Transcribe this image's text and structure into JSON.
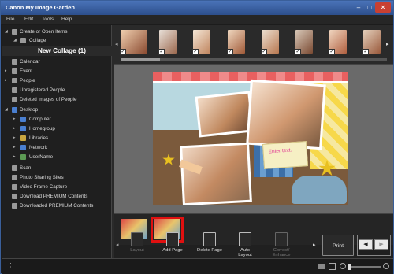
{
  "window": {
    "title": "Canon My Image Garden",
    "min": "–",
    "max": "□",
    "close": "✕"
  },
  "menu": [
    "File",
    "Edit",
    "Tools",
    "Help"
  ],
  "sidebar": {
    "items": [
      {
        "label": "Create or Open Items",
        "arrow": "◢",
        "icon": "folder"
      },
      {
        "label": "Collage",
        "arrow": "◢",
        "icon": "collage"
      },
      {
        "label": "New Collage (1)",
        "arrow": "",
        "icon": ""
      },
      {
        "label": "Calendar",
        "arrow": "",
        "icon": "calendar"
      },
      {
        "label": "Event",
        "arrow": "▸",
        "icon": "event"
      },
      {
        "label": "People",
        "arrow": "▸",
        "icon": "people"
      },
      {
        "label": "Unregistered People",
        "arrow": "",
        "icon": "people"
      },
      {
        "label": "Deleted Images of People",
        "arrow": "",
        "icon": "people"
      },
      {
        "label": "Desktop",
        "arrow": "◢",
        "icon": "desktop"
      },
      {
        "label": "Computer",
        "arrow": "▸",
        "icon": "computer"
      },
      {
        "label": "Homegroup",
        "arrow": "▸",
        "icon": "homegroup"
      },
      {
        "label": "Libraries",
        "arrow": "▸",
        "icon": "libraries"
      },
      {
        "label": "Network",
        "arrow": "▸",
        "icon": "network"
      },
      {
        "label": "UserName",
        "arrow": "▸",
        "icon": "user"
      },
      {
        "label": "Scan",
        "arrow": "",
        "icon": "scan"
      },
      {
        "label": "Photo Sharing Sites",
        "arrow": "",
        "icon": "photo"
      },
      {
        "label": "Video Frame Capture",
        "arrow": "",
        "icon": "video"
      },
      {
        "label": "Download PREMIUM Contents",
        "arrow": "",
        "icon": "download"
      },
      {
        "label": "Downloaded PREMIUM Contents",
        "arrow": "",
        "icon": "downloaded"
      }
    ]
  },
  "toolbar": {
    "layout": "Layout",
    "add_page": "Add Page",
    "delete_page": "Delete Page",
    "auto_layout_1": "Auto",
    "auto_layout_2": "Layout",
    "correct_enhance_1": "Correct/",
    "correct_enhance_2": "Enhance",
    "print": "Print",
    "prev_page": "◀",
    "next_page": "▶",
    "left_arrow": "◂",
    "right_arrow": "▸"
  },
  "canvas": {
    "enter_text": "Enter text."
  },
  "colors": {
    "selected_border": "#e01010",
    "title_bar": "#3b63a8"
  }
}
